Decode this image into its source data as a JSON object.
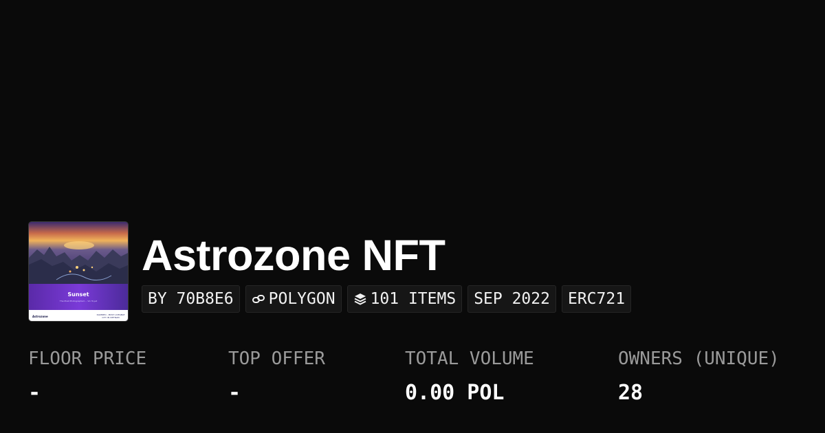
{
  "collection": {
    "name": "Astrozone NFT",
    "thumbnail": {
      "title": "Sunset",
      "subtitle": "The Most Photographed ... Vin Tuyet",
      "brand": "Astrozone",
      "tagline": "DAKMIEO - MOST LIVEABLE CITY IN VIETNAM"
    }
  },
  "meta": {
    "creator": "BY 70B8E6",
    "chain": "POLYGON",
    "items": "101 ITEMS",
    "created": "SEP 2022",
    "standard": "ERC721"
  },
  "stats": {
    "floor_price": {
      "label": "FLOOR PRICE",
      "value": "-"
    },
    "top_offer": {
      "label": "TOP OFFER",
      "value": "-"
    },
    "total_volume": {
      "label": "TOTAL VOLUME",
      "value": "0.00 POL"
    },
    "owners": {
      "label": "OWNERS (UNIQUE)",
      "value": "28"
    }
  },
  "colors": {
    "background": "#0a0a0a",
    "chip_background": "#161616",
    "label_gray": "#9a9a9a",
    "text": "#ffffff"
  },
  "icons": {
    "chain": "link-icon",
    "items": "layers-icon"
  }
}
